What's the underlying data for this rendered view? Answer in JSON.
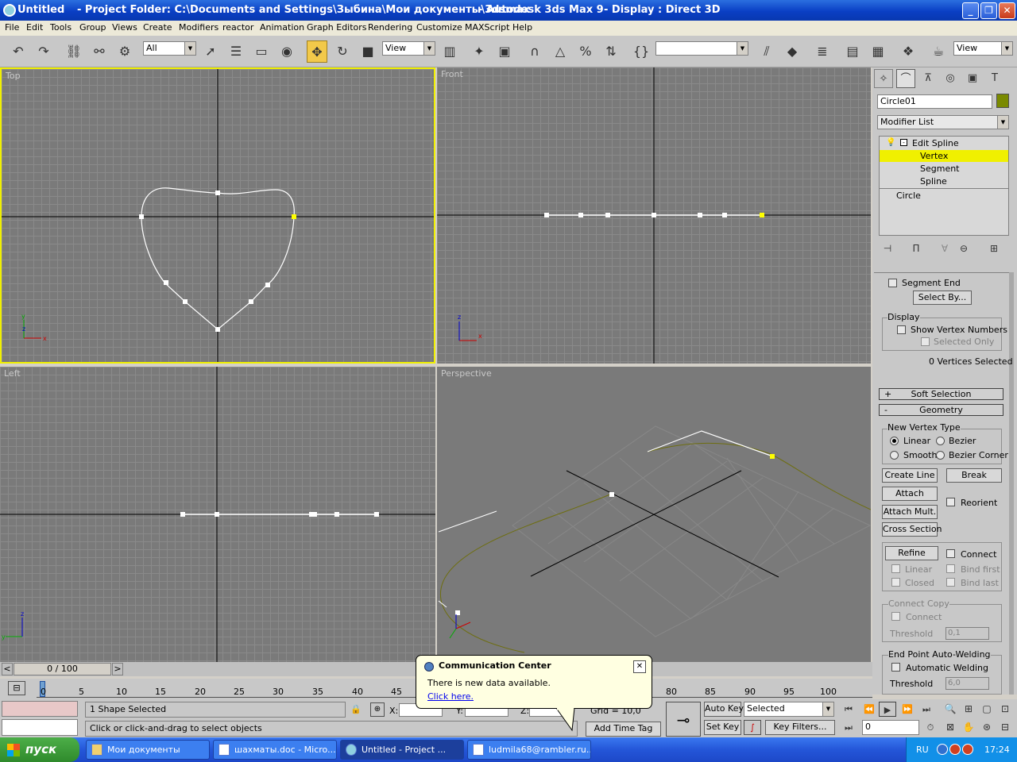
{
  "titlebar": {
    "app_name": "Untitled",
    "project": "- Project Folder: C:\\Documents and Settings\\Зыбина\\Мои документы\\3dsmax",
    "product": "- Autodesk 3ds Max 9",
    "display": "- Display : Direct 3D",
    "min": "_",
    "max": "❐",
    "close": "✕"
  },
  "menu": [
    "File",
    "Edit",
    "Tools",
    "Group",
    "Views",
    "Create",
    "Modifiers",
    "reactor",
    "Animation",
    "Graph Editors",
    "Rendering",
    "Customize",
    "MAXScript",
    "Help"
  ],
  "toolbar": {
    "selection_filter": "All",
    "ref_coord": "View",
    "named_selection": "",
    "render_view": "View"
  },
  "viewports": {
    "top": "Top",
    "front": "Front",
    "left": "Left",
    "perspective": "Perspective"
  },
  "panel": {
    "object_name": "Circle01",
    "object_color": "#7a8a00",
    "modifier_list": "Modifier List",
    "stack": [
      "Edit Spline",
      "Vertex",
      "Segment",
      "Spline",
      "Circle"
    ],
    "segment_end": "Segment End",
    "select_by": "Select By...",
    "display_group": "Display",
    "show_vertex_numbers": "Show Vertex Numbers",
    "selected_only": "Selected Only",
    "vertices_selected": "0 Vertices Selected",
    "soft_selection": "Soft Selection",
    "soft_plus": "+",
    "geometry": "Geometry",
    "geo_minus": "-",
    "new_vertex_type": "New Vertex Type",
    "linear": "Linear",
    "bezier": "Bezier",
    "smooth": "Smooth",
    "bezier_corner": "Bezier Corner",
    "create_line": "Create Line",
    "break": "Break",
    "attach": "Attach",
    "reorient": "Reorient",
    "attach_mult": "Attach Mult.",
    "cross_section": "Cross Section",
    "refine": "Refine",
    "connect": "Connect",
    "linear2": "Linear",
    "bind_first": "Bind first",
    "closed": "Closed",
    "bind_last": "Bind last",
    "connect_copy": "Connect Copy",
    "connect2": "Connect",
    "threshold_label": "Threshold",
    "threshold_value": "0,1",
    "end_point_welding": "End Point Auto-Welding",
    "automatic_welding": "Automatic Welding",
    "threshold2_label": "Threshold",
    "threshold2_value": "6,0"
  },
  "timeline": {
    "frame": "0 / 100",
    "prev": "<",
    "next": ">",
    "ticks": [
      "0",
      "5",
      "10",
      "15",
      "20",
      "25",
      "30",
      "35",
      "40",
      "45",
      "80",
      "85",
      "90",
      "95",
      "100"
    ]
  },
  "status": {
    "shapes": "1 Shape Selected",
    "prompt": "Click or click-and-drag to select objects",
    "x_label": "X:",
    "y_label": "Y:",
    "z_label": "Z:",
    "grid": "Grid = 10,0",
    "add_time_tag": "Add Time Tag",
    "auto_key": "Auto Key",
    "selected": "Selected",
    "set_key": "Set Key",
    "key_filters": "Key Filters...",
    "frame_value": "0"
  },
  "balloon": {
    "title": "Communication Center",
    "text": "There is new data available.",
    "link": "Click here.",
    "close": "✕"
  },
  "taskbar": {
    "start": "пуск",
    "tasks": [
      "Мои документы",
      "шахматы.doc - Micro...",
      "Untitled      - Project ...",
      "ludmila68@rambler.ru..."
    ],
    "lang": "RU",
    "clock": "17:24"
  }
}
